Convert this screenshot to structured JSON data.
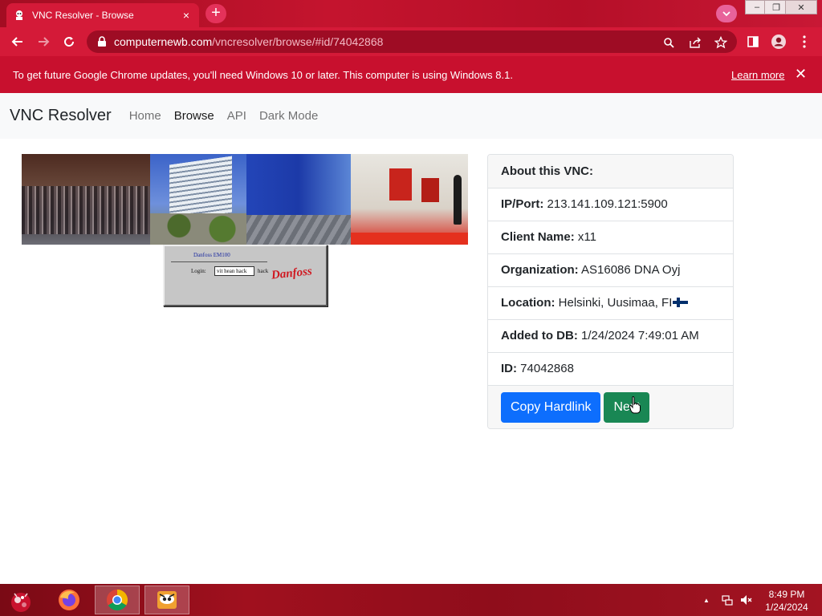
{
  "browser": {
    "tab_title": "VNC Resolver - Browse",
    "tab_close": "×",
    "new_tab": "+",
    "window_controls": [
      "–",
      "❐",
      "✕"
    ],
    "url_domain": "computernewb.com",
    "url_path": "/vncresolver/browse/#id/74042868",
    "theme_color": "#d41a38"
  },
  "infobar": {
    "message": "To get future Google Chrome updates, you'll need Windows 10 or later. This computer is using Windows 8.1.",
    "learn_more": "Learn more",
    "close": "✕"
  },
  "navbar": {
    "brand": "VNC Resolver",
    "links": [
      "Home",
      "Browse",
      "API",
      "Dark Mode"
    ],
    "active": "Browse"
  },
  "screenshot": {
    "title": "Danfoss EM100",
    "login_label": "Login:",
    "login_value": "vit hean hack",
    "after_field": "hack",
    "logo_text": "Danfoss"
  },
  "about": {
    "header": "About this VNC:",
    "ip_label": "IP/Port:",
    "ip_value": "213.141.109.121:5900",
    "client_label": "Client Name:",
    "client_value": "x11",
    "org_label": "Organization:",
    "org_value": "AS16086 DNA Oyj",
    "location_label": "Location:",
    "location_value": "Helsinki, Uusimaa, FI",
    "added_label": "Added to DB:",
    "added_value": "1/24/2024 7:49:01 AM",
    "id_label": "ID:",
    "id_value": "74042868",
    "copy_button": "Copy Hardlink",
    "next_button": "Next"
  },
  "taskbar": {
    "time": "8:49 PM",
    "date": "1/24/2024",
    "apps": [
      "firefox-icon",
      "chrome-icon",
      "vnc-viewer-icon"
    ],
    "tray_up": "▲"
  }
}
